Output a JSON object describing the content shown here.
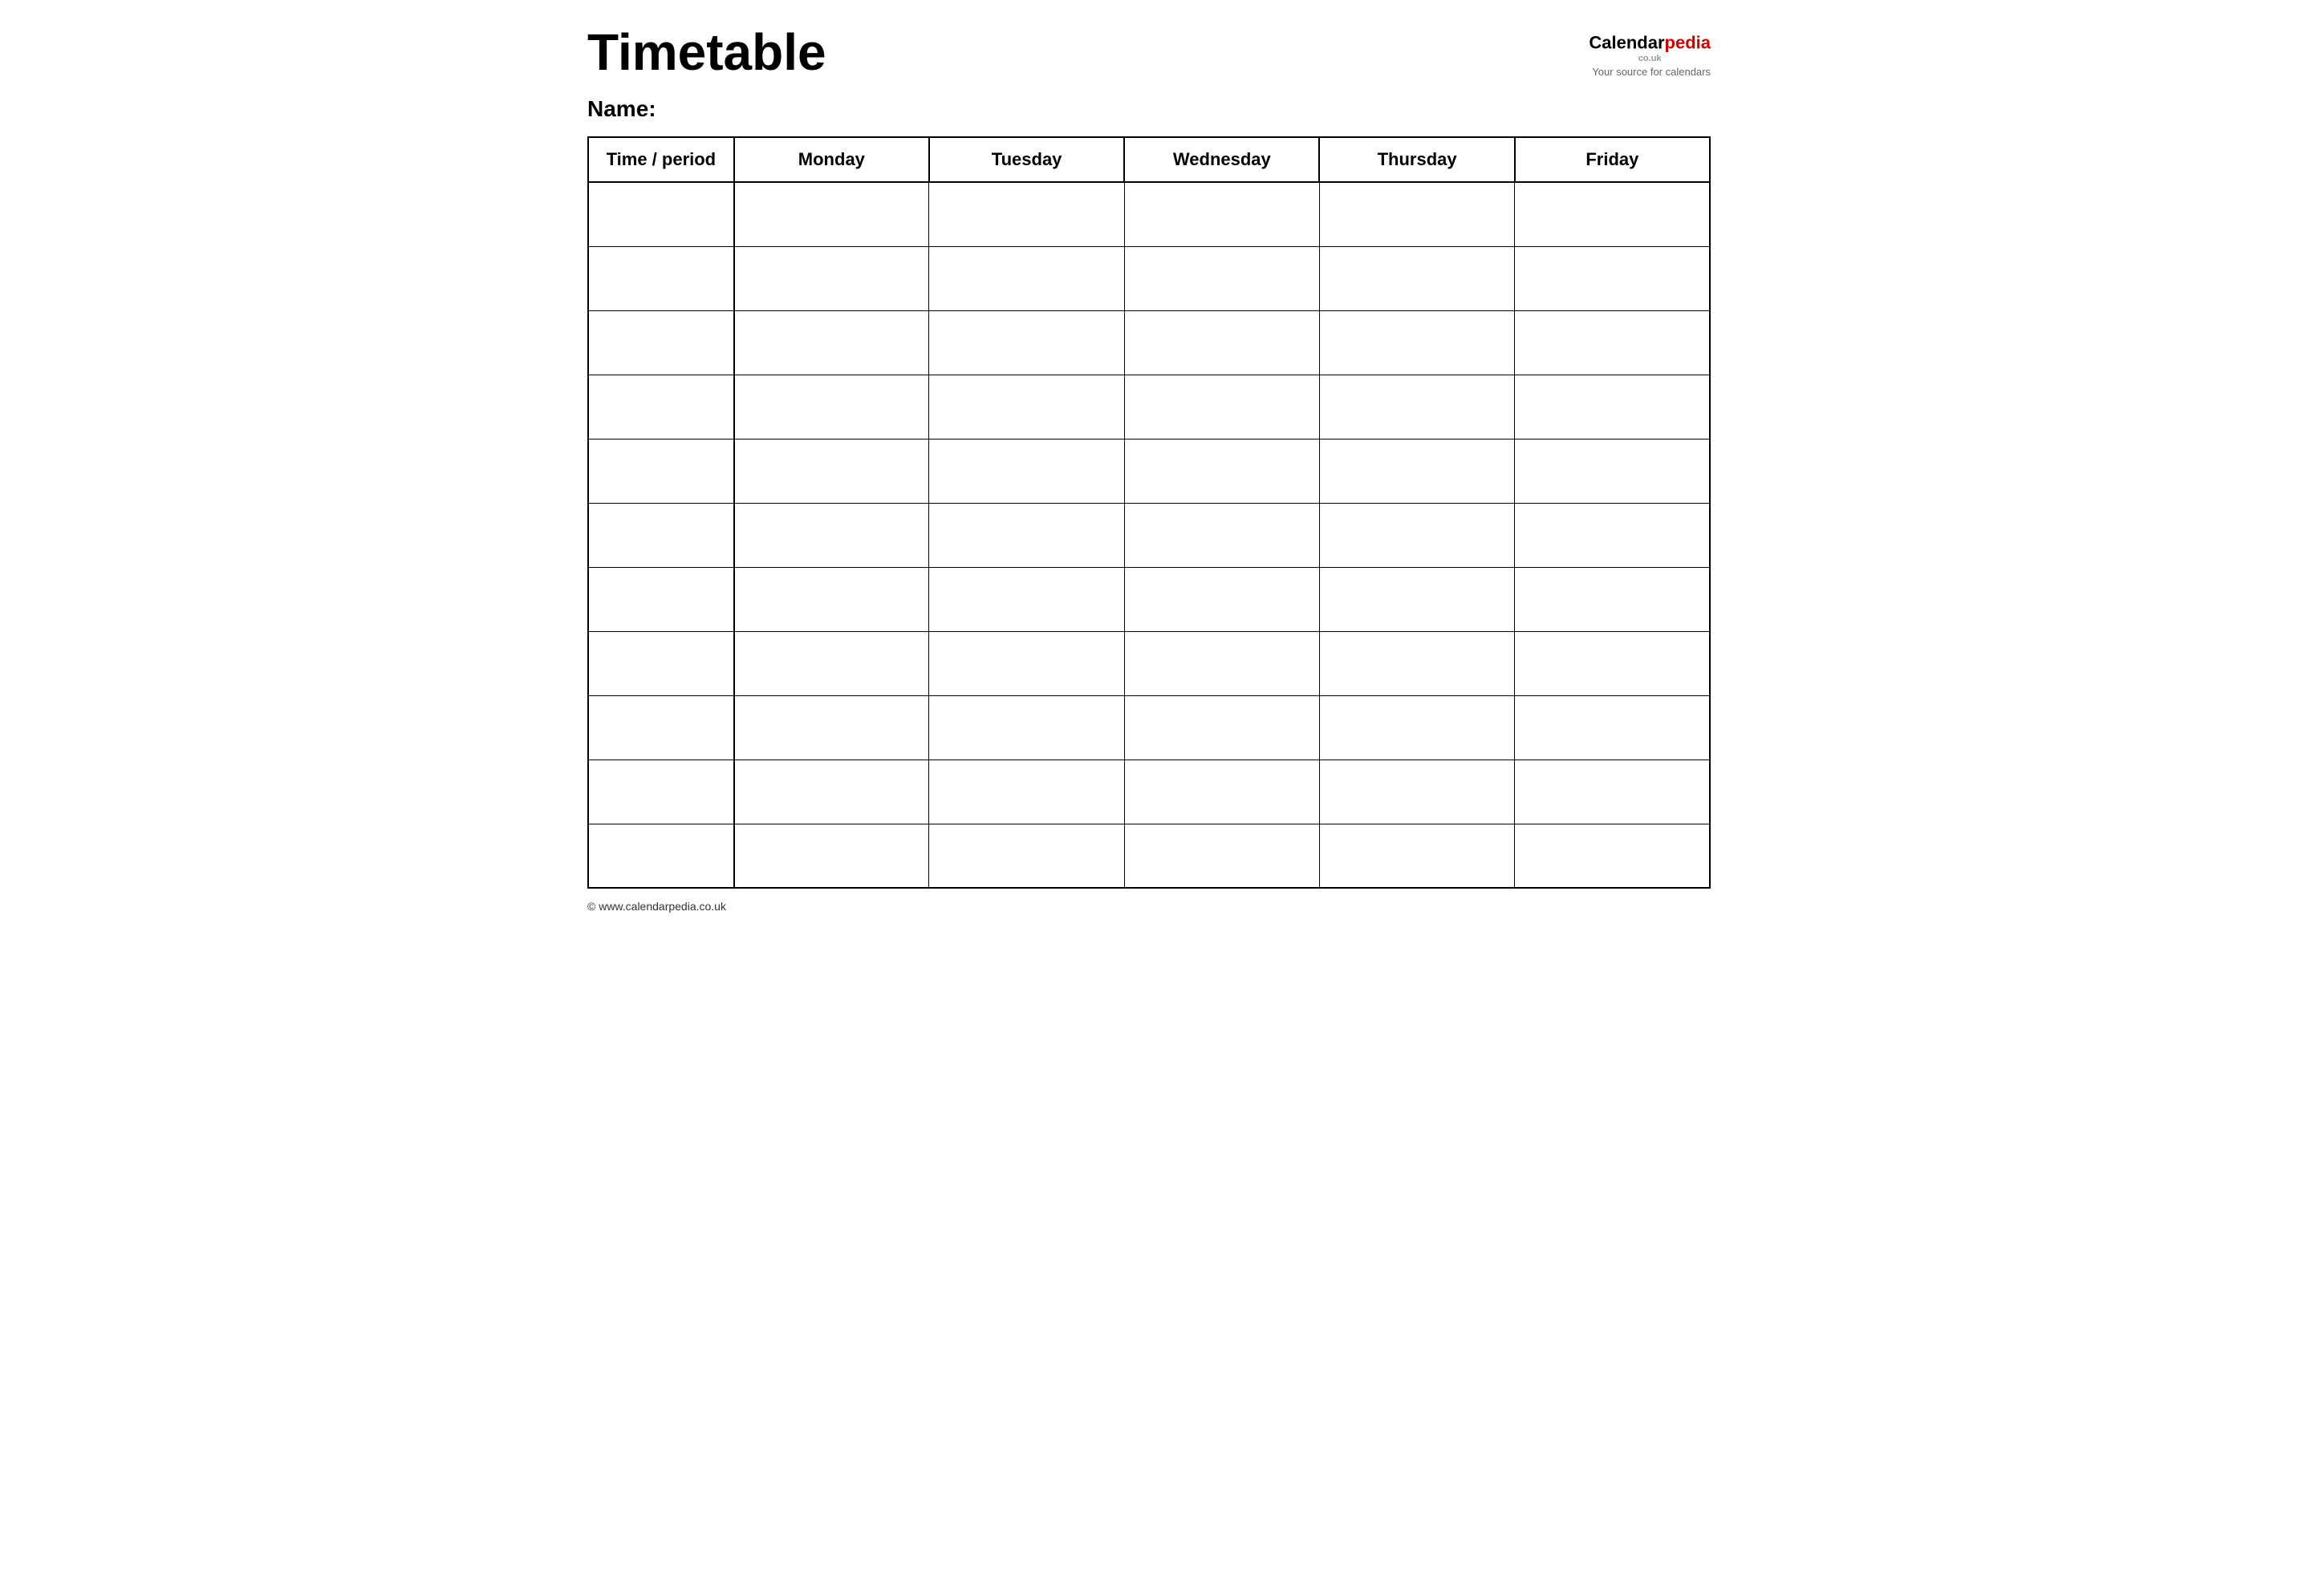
{
  "header": {
    "title": "Timetable",
    "logo": {
      "calendar": "Calendar",
      "pedia": "pedia",
      "couk": "co.uk",
      "tagline": "Your source for calendars"
    }
  },
  "name_label": "Name:",
  "table": {
    "columns": [
      {
        "id": "time",
        "label": "Time / period"
      },
      {
        "id": "monday",
        "label": "Monday"
      },
      {
        "id": "tuesday",
        "label": "Tuesday"
      },
      {
        "id": "wednesday",
        "label": "Wednesday"
      },
      {
        "id": "thursday",
        "label": "Thursday"
      },
      {
        "id": "friday",
        "label": "Friday"
      }
    ],
    "rows": 11
  },
  "footer": {
    "url": "© www.calendarpedia.co.uk"
  }
}
